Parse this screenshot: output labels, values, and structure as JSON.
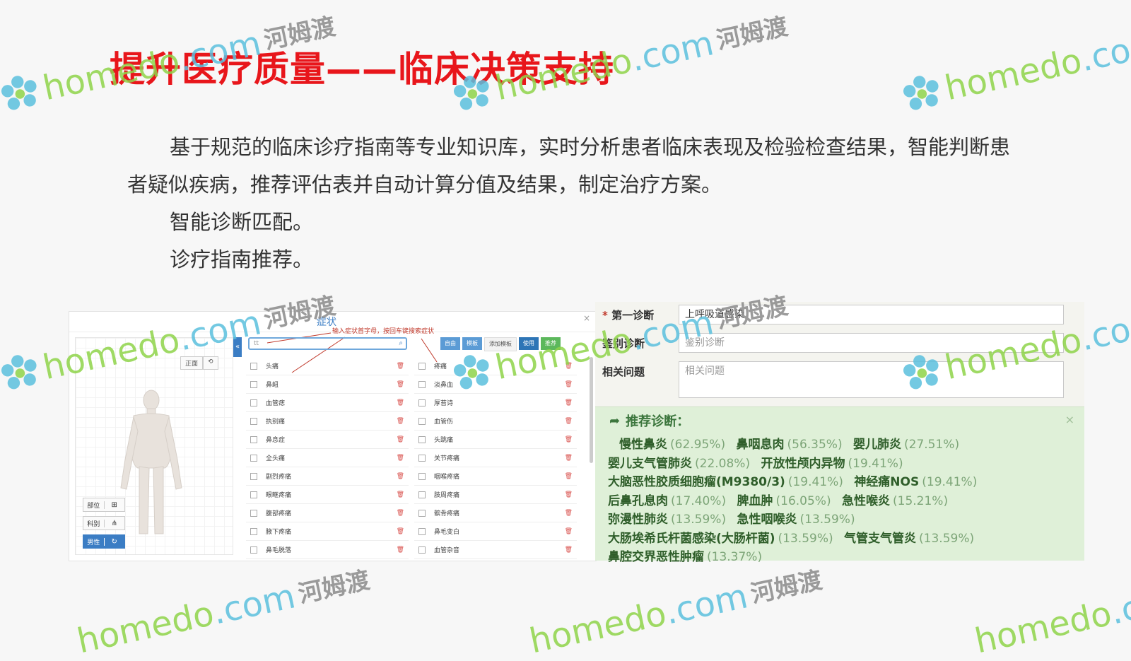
{
  "slide": {
    "title": "提升医疗质量——临床决策支持",
    "paragraphs": [
      "基于规范的临床诊疗指南等专业知识库，实时分析患者临床表现及检验检查结果，智能判断患者疑似疾病，推荐评估表并自动计算分值及结果，制定治疗方案。",
      "智能诊断匹配。",
      "诊疗指南推荐。"
    ]
  },
  "left_panel": {
    "title": "症状",
    "close": "×",
    "view_front": "正面",
    "view_flip": "⟲",
    "side_buttons": [
      {
        "label": "部位",
        "icon": "sitemap-icon"
      },
      {
        "label": "科别",
        "icon": "hierarchy-icon"
      },
      {
        "label": "男性",
        "icon": "refresh-icon"
      }
    ],
    "collapse": "«",
    "search_value": "tt",
    "annotation": "输入症状首字母，按回车键搜索症状",
    "toolbar": [
      "自由",
      "模板",
      "添加模板",
      "使用",
      "推荐"
    ],
    "symptoms_left": [
      "头痛",
      "鼻衄",
      "血管痣",
      "执别痛",
      "鼻息症",
      "全头痛",
      "剧烈疼痛",
      "眼眶疼痛",
      "腹部疼痛",
      "腋下疼痛",
      "鼻毛脱落"
    ],
    "symptoms_right": [
      "疼痛",
      "淡鼻血",
      "厚苔诗",
      "血管伤",
      "头跳痛",
      "关节疼痛",
      "咽喉疼痛",
      "肢周疼痛",
      "髌骨疼痛",
      "鼻毛变白",
      "血管杂音"
    ]
  },
  "right_panel": {
    "primary_label": "第一诊断",
    "primary_value": "上呼吸道感染",
    "differential_label": "鉴别诊断",
    "differential_placeholder": "鉴别诊断",
    "related_label": "相关问题",
    "related_placeholder": "相关问题",
    "rec_title": "推荐诊断：",
    "rec_close": "×",
    "recommendations": [
      {
        "name": "慢性鼻炎",
        "pct": "(62.95%)"
      },
      {
        "name": "鼻咽息肉",
        "pct": "(56.35%)"
      },
      {
        "name": "婴儿肺炎",
        "pct": "(27.51%)"
      },
      {
        "name": "婴儿支气管肺炎",
        "pct": "(22.08%)"
      },
      {
        "name": "开放性颅内异物",
        "pct": "(19.41%)"
      },
      {
        "name": "大脑恶性胶质细胞瘤(M9380/3)",
        "pct": "(19.41%)"
      },
      {
        "name": "神经痛NOS",
        "pct": "(19.41%)"
      },
      {
        "name": "后鼻孔息肉",
        "pct": "(17.40%)"
      },
      {
        "name": "脾血肿",
        "pct": "(16.05%)"
      },
      {
        "name": "急性喉炎",
        "pct": "(15.21%)"
      },
      {
        "name": "弥漫性肺炎",
        "pct": "(13.59%)"
      },
      {
        "name": "急性咽喉炎",
        "pct": "(13.59%)"
      },
      {
        "name": "大肠埃希氏杆菌感染(大肠杆菌)",
        "pct": "(13.59%)"
      },
      {
        "name": "气管支气管炎",
        "pct": "(13.59%)"
      },
      {
        "name": "鼻腔交界恶性肿瘤",
        "pct": "(13.37%)"
      }
    ]
  },
  "watermark": {
    "brand": "homedo",
    "domain": ".com",
    "cn": "河姆渡"
  },
  "colors": {
    "title": "#e8161b",
    "accent": "#3b7dc4",
    "rec_bg": "#dff0d8"
  }
}
